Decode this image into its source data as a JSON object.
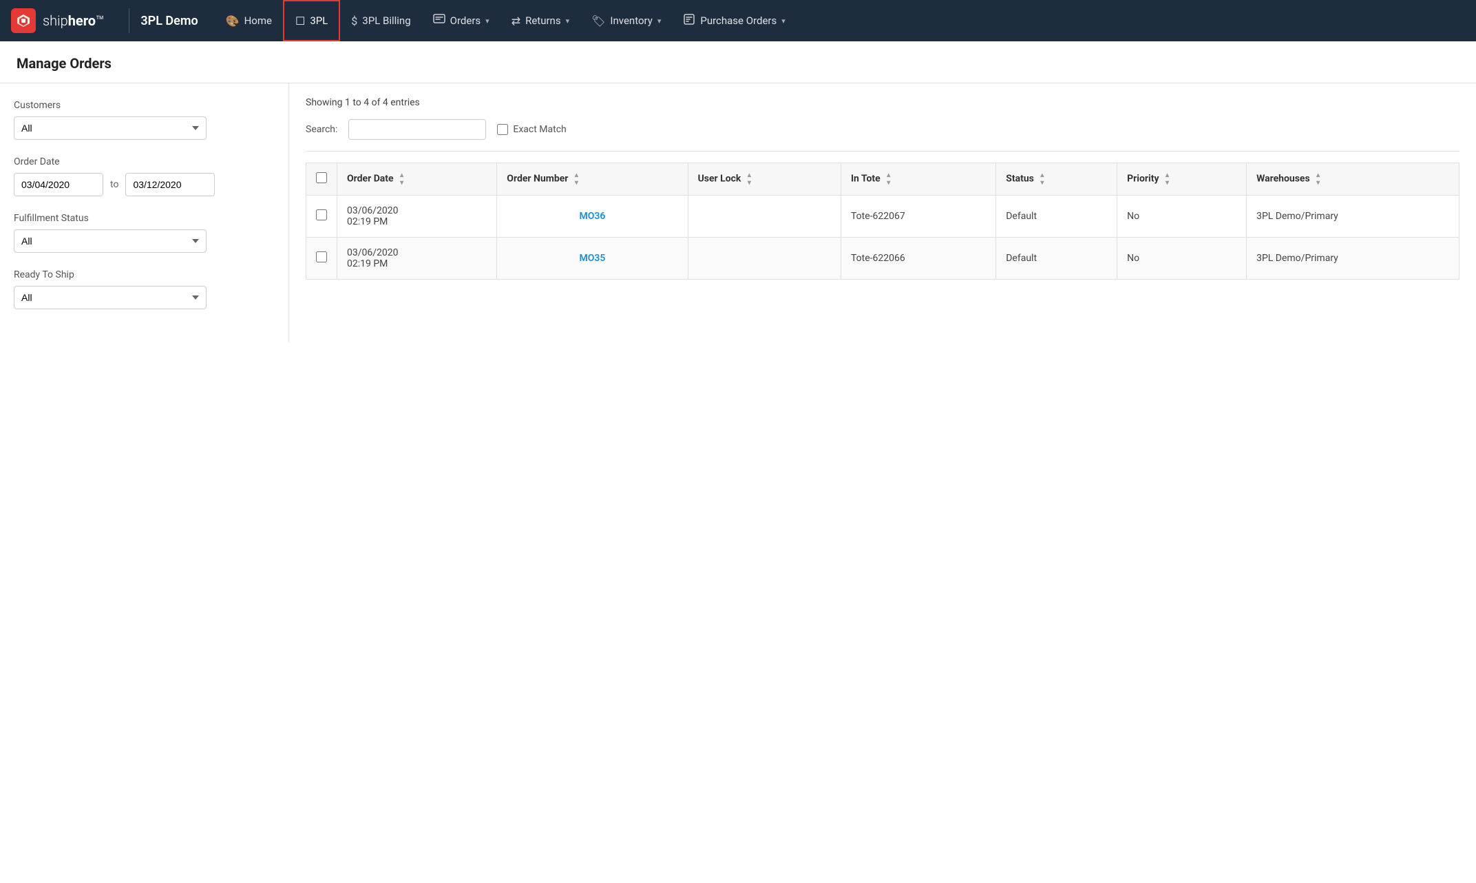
{
  "brand": {
    "logo_text": "S",
    "name_prefix": "ship",
    "name_suffix": "hero™",
    "app_title": "3PL Demo"
  },
  "nav": {
    "items": [
      {
        "id": "home",
        "label": "Home",
        "icon": "🎨",
        "has_dropdown": false,
        "active": false
      },
      {
        "id": "3pl",
        "label": "3PL",
        "icon": "☐",
        "has_dropdown": false,
        "active": true
      },
      {
        "id": "3pl-billing",
        "label": "3PL Billing",
        "icon": "$",
        "has_dropdown": false,
        "active": false
      },
      {
        "id": "orders",
        "label": "Orders",
        "icon": "📥",
        "has_dropdown": true,
        "active": false
      },
      {
        "id": "returns",
        "label": "Returns",
        "icon": "⇄",
        "has_dropdown": true,
        "active": false
      },
      {
        "id": "inventory",
        "label": "Inventory",
        "icon": "🏷",
        "has_dropdown": true,
        "active": false
      },
      {
        "id": "purchase-orders",
        "label": "Purchase Orders",
        "icon": "📦",
        "has_dropdown": true,
        "active": false
      }
    ]
  },
  "page": {
    "title": "Manage Orders"
  },
  "filters": {
    "customers_label": "Customers",
    "customers_value": "All",
    "customers_options": [
      "All"
    ],
    "order_date_label": "Order Date",
    "order_date_from": "03/04/2020",
    "order_date_to": "03/12/2020",
    "date_separator": "to",
    "fulfillment_status_label": "Fulfillment Status",
    "fulfillment_status_value": "All",
    "fulfillment_status_options": [
      "All"
    ],
    "ready_to_ship_label": "Ready To Ship",
    "ready_to_ship_value": "All",
    "ready_to_ship_options": [
      "All"
    ]
  },
  "table": {
    "entries_info": "Showing 1 to 4 of 4 entries",
    "search_label": "Search:",
    "search_placeholder": "",
    "exact_match_label": "Exact Match",
    "columns": [
      {
        "id": "order-date",
        "label": "Order Date",
        "sortable": true
      },
      {
        "id": "order-number",
        "label": "Order Number",
        "sortable": true
      },
      {
        "id": "user-lock",
        "label": "User Lock",
        "sortable": true
      },
      {
        "id": "in-tote",
        "label": "In Tote",
        "sortable": true
      },
      {
        "id": "status",
        "label": "Status",
        "sortable": true
      },
      {
        "id": "priority",
        "label": "Priority",
        "sortable": true
      },
      {
        "id": "warehouses",
        "label": "Warehouses",
        "sortable": true
      }
    ],
    "rows": [
      {
        "order_date": "03/06/2020\n02:19 PM",
        "order_number": "MO36",
        "user_lock": "",
        "in_tote": "Tote-622067",
        "status": "Default",
        "priority": "No",
        "warehouses": "3PL Demo/Primary"
      },
      {
        "order_date": "03/06/2020\n02:19 PM",
        "order_number": "MO35",
        "user_lock": "",
        "in_tote": "Tote-622066",
        "status": "Default",
        "priority": "No",
        "warehouses": "3PL Demo/Primary"
      }
    ]
  }
}
